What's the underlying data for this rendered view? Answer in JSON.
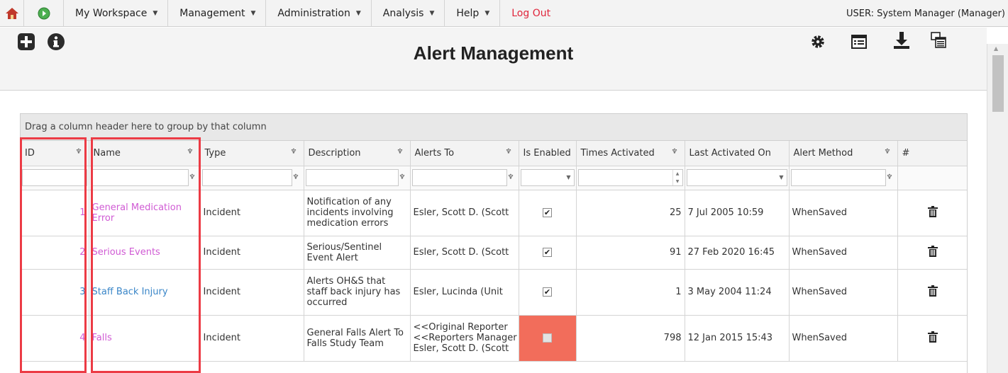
{
  "nav": {
    "items": [
      {
        "label": "My Workspace"
      },
      {
        "label": "Management"
      },
      {
        "label": "Administration"
      },
      {
        "label": "Analysis"
      },
      {
        "label": "Help"
      }
    ],
    "logout": "Log Out",
    "user": "USER: System Manager (Manager)",
    "caret": "▼"
  },
  "header": {
    "title": "Alert Management"
  },
  "grid": {
    "group_hint": "Drag a column header here to group by that column",
    "columns": [
      "ID",
      "Name",
      "Type",
      "Description",
      "Alerts To",
      "Is Enabled",
      "Times Activated",
      "Last Activated On",
      "Alert Method",
      "#"
    ],
    "rows": [
      {
        "id": "1",
        "name": "General Medication Error",
        "type": "Incident",
        "description": "Notification of any incidents involving medication errors",
        "alerts_to": "Esler, Scott D. (Scott",
        "enabled": true,
        "times": "25",
        "last": "7 Jul 2005 10:59",
        "method": "WhenSaved"
      },
      {
        "id": "2",
        "name": "Serious Events",
        "type": "Incident",
        "description": "Serious/Sentinel Event Alert",
        "alerts_to": "Esler, Scott D. (Scott",
        "enabled": true,
        "times": "91",
        "last": "27 Feb 2020 16:45",
        "method": "WhenSaved"
      },
      {
        "id": "3",
        "name": "Staff Back Injury",
        "type": "Incident",
        "description": "Alerts OH&S that staff back injury has occurred",
        "alerts_to": "Esler, Lucinda (Unit",
        "enabled": true,
        "times": "1",
        "last": "3 May 2004 11:24",
        "method": "WhenSaved"
      },
      {
        "id": "4",
        "name": "Falls",
        "type": "Incident",
        "description": "General Falls Alert To Falls Study Team",
        "alerts_to": "<<Original Reporter<<Reporters ManagerEsler, Scott D. (Scott",
        "alerts_lines": [
          "<<Original Reporter",
          "<<Reporters Manager",
          "Esler, Scott D. (Scott"
        ],
        "enabled": false,
        "times": "798",
        "last": "12 Jan 2015 15:43",
        "method": "WhenSaved"
      }
    ]
  },
  "colors": {
    "accent_red": "#ec3b45",
    "link_pink": "#d05bd4",
    "link_blue": "#3a86c8",
    "disabled_cell": "#f26d5b"
  }
}
